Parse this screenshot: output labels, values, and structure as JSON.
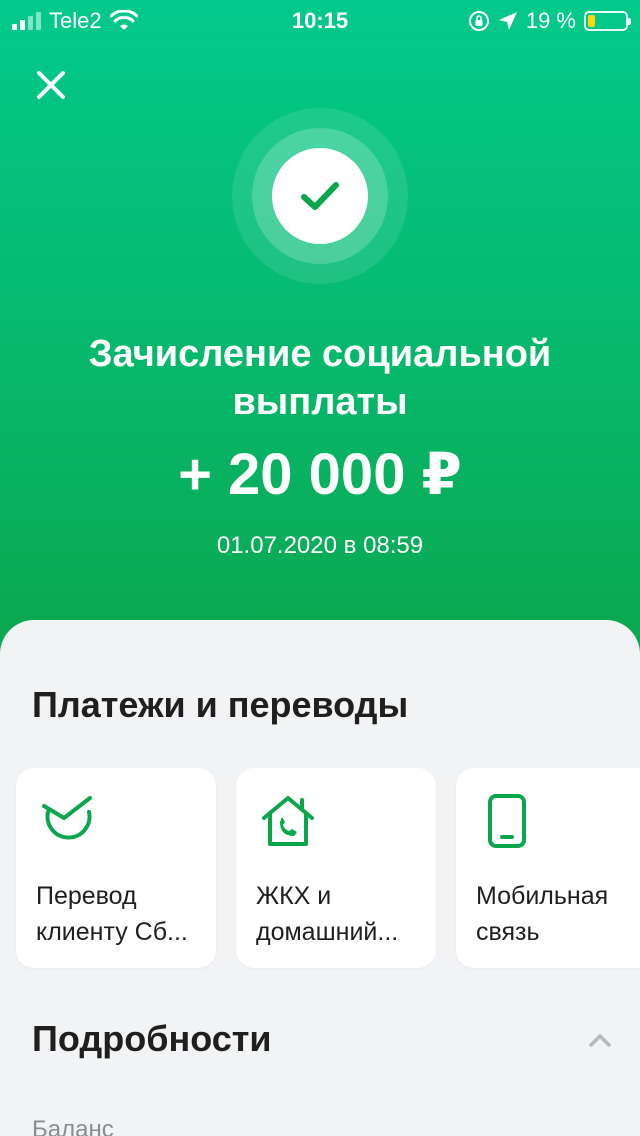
{
  "status_bar": {
    "carrier": "Tele2",
    "time": "10:15",
    "battery_percent": "19 %",
    "battery_level": 0.19
  },
  "hero": {
    "title_line1": "Зачисление социальной",
    "title_line2": "выплаты",
    "amount": "+ 20 000 ₽",
    "datetime": "01.07.2020 в 08:59"
  },
  "payments": {
    "title": "Платежи и переводы",
    "cards": [
      {
        "icon": "sber-logo-icon",
        "line1": "Перевод",
        "line2": "клиенту Сб..."
      },
      {
        "icon": "house-phone-icon",
        "line1": "ЖКХ и",
        "line2": "домашний..."
      },
      {
        "icon": "mobile-phone-icon",
        "line1": "Мобильная",
        "line2": "связь"
      }
    ]
  },
  "details": {
    "title": "Подробности",
    "balance_label": "Баланс"
  },
  "colors": {
    "accent": "#0aa64c",
    "hero_top": "#03c98c",
    "battery_low": "#ffd60a"
  }
}
